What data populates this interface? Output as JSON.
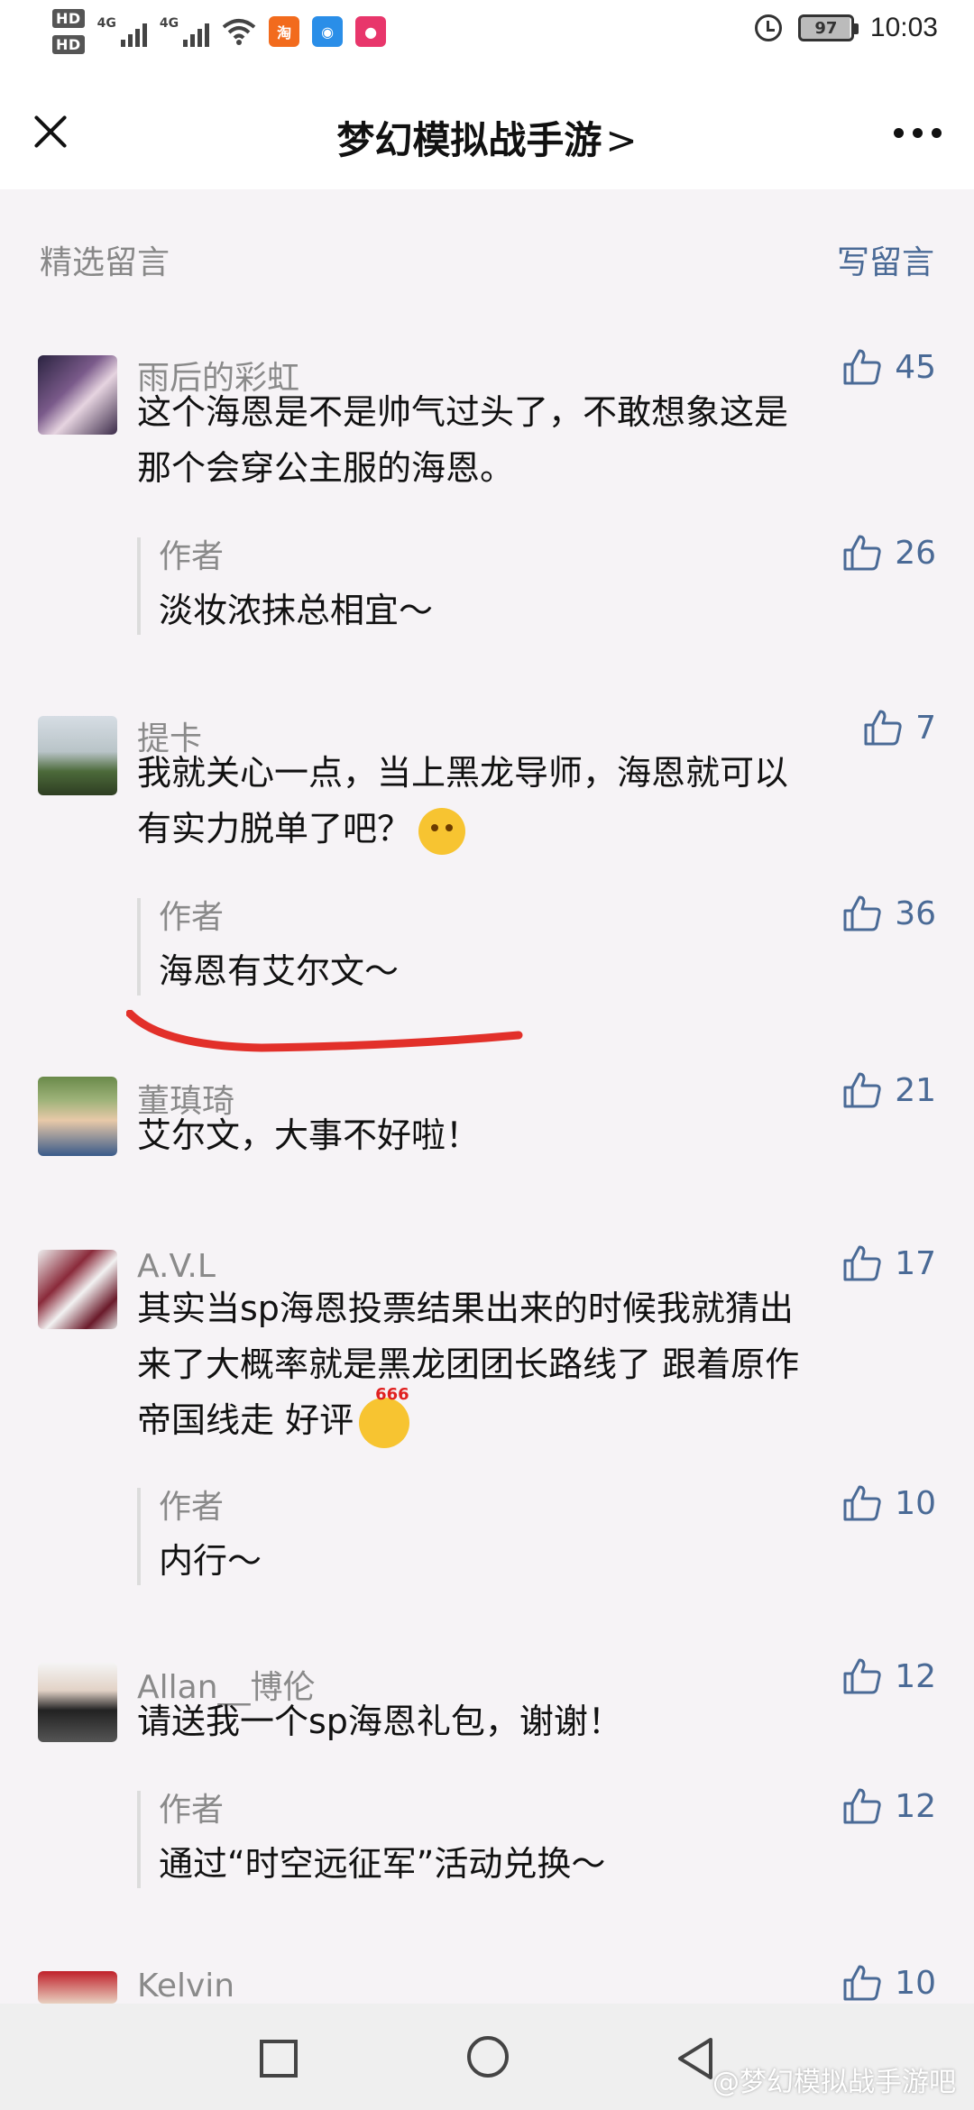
{
  "status_bar": {
    "hd1": "HD",
    "hd2": "HD",
    "net1": "4G",
    "net2": "4G",
    "battery": "97",
    "time": "10:03"
  },
  "header": {
    "title": "梦幻模拟战手游",
    "title_chevron": ">",
    "close_icon": "close-icon",
    "more_icon": "more-dots-icon"
  },
  "section": {
    "label": "精选留言",
    "write_label": "写留言"
  },
  "colors": {
    "link": "#4a6a96",
    "muted": "#8a8a8a",
    "annotation": "#e2302a"
  },
  "comments": [
    {
      "name": "雨后的彩虹",
      "likes": "45",
      "text_lines": [
        "这个海恩是不是帅气过头了，不敢想象这是",
        "那个会穿公主服的海恩。"
      ],
      "reply": {
        "author": "作者",
        "likes": "26",
        "text": "淡妆浓抹总相宜～"
      }
    },
    {
      "name": "提卡",
      "likes": "7",
      "text_lines": [
        "我就关心一点，当上黑龙导师，海恩就可以",
        "有实力脱单了吧？"
      ],
      "reply": {
        "author": "作者",
        "likes": "36",
        "text": "海恩有艾尔文～"
      }
    },
    {
      "name": "董瑱琦",
      "likes": "21",
      "text_lines": [
        "艾尔文，大事不好啦！"
      ]
    },
    {
      "name": "A.V.L",
      "likes": "17",
      "text_lines": [
        "其实当sp海恩投票结果出来的时候我就猜出",
        "来了大概率就是黑龙团团长路线了 跟着原作",
        "帝国线走 好评"
      ],
      "emoji_badge": "666",
      "reply": {
        "author": "作者",
        "likes": "10",
        "text": "内行～"
      }
    },
    {
      "name": "Allan__博伦",
      "likes": "12",
      "text_lines": [
        "请送我一个sp海恩礼包，谢谢！"
      ],
      "reply": {
        "author": "作者",
        "likes": "12",
        "text": "通过“时空远征军”活动兑换～"
      }
    },
    {
      "name": "Kelvin",
      "likes": "10",
      "text_lines": []
    }
  ],
  "watermark": "@梦幻模拟战手游吧"
}
